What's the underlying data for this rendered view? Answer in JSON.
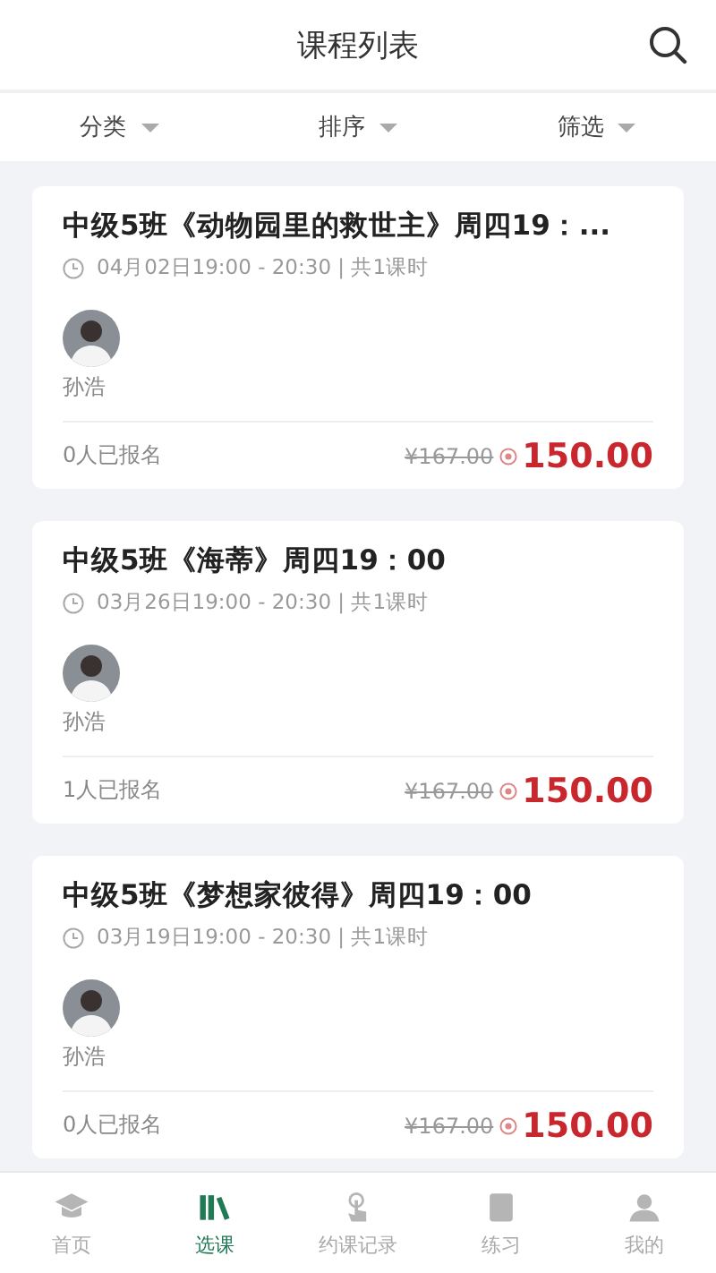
{
  "header": {
    "title": "课程列表"
  },
  "filters": [
    {
      "label": "分类"
    },
    {
      "label": "排序"
    },
    {
      "label": "筛选"
    }
  ],
  "courses": [
    {
      "title": "中级5班《动物园里的救世主》周四19：...",
      "time": "04月02日19:00 - 20:30 | 共1课时",
      "teacher": "孙浩",
      "enrolled": "0人已报名",
      "old_price": "¥167.00",
      "price": "150.00"
    },
    {
      "title": "中级5班《海蒂》周四19：00",
      "time": "03月26日19:00 - 20:30 | 共1课时",
      "teacher": "孙浩",
      "enrolled": "1人已报名",
      "old_price": "¥167.00",
      "price": "150.00"
    },
    {
      "title": "中级5班《梦想家彼得》周四19：00",
      "time": "03月19日19:00 - 20:30 | 共1课时",
      "teacher": "孙浩",
      "enrolled": "0人已报名",
      "old_price": "¥167.00",
      "price": "150.00"
    }
  ],
  "nav": [
    {
      "label": "首页",
      "kind": "home",
      "selected": false
    },
    {
      "label": "选课",
      "kind": "books",
      "selected": true
    },
    {
      "label": "约课记录",
      "kind": "touch",
      "selected": false
    },
    {
      "label": "练习",
      "kind": "practice",
      "selected": false
    },
    {
      "label": "我的",
      "kind": "user",
      "selected": false
    }
  ]
}
